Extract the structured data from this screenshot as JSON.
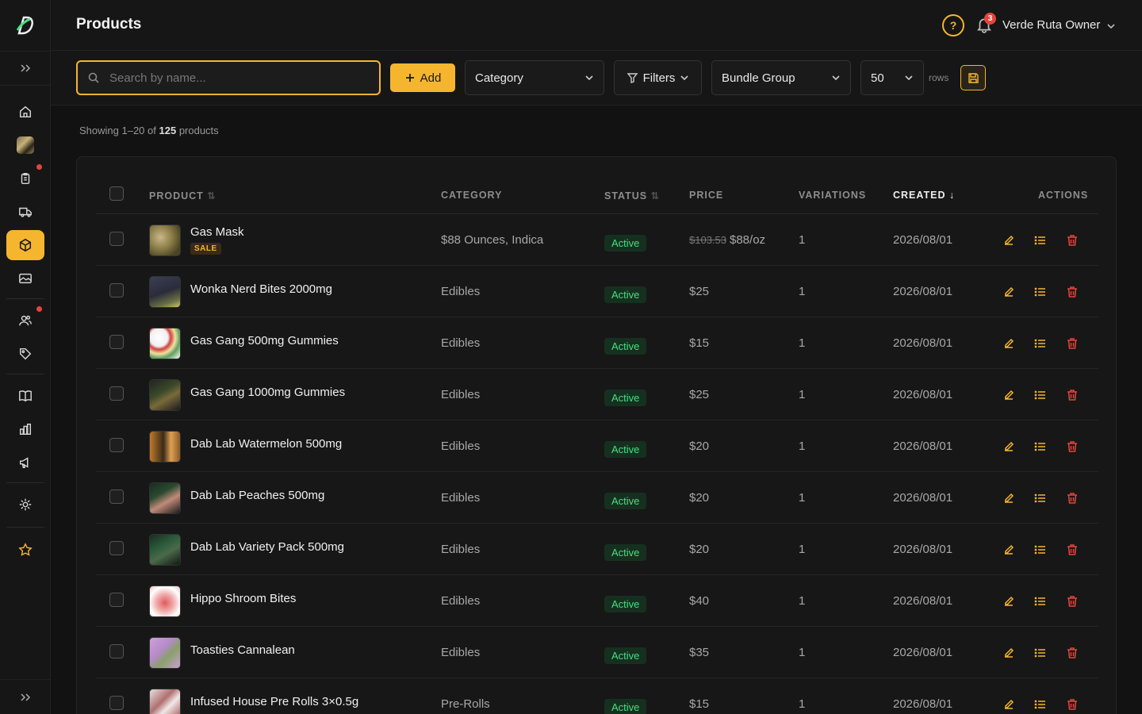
{
  "header": {
    "title": "Products",
    "help_label": "?",
    "notification_count": "3",
    "user_name": "Verde Ruta Owner"
  },
  "toolbar": {
    "search_placeholder": "Search by name...",
    "add_label": "Add",
    "category_label": "Category",
    "filters_label": "Filters",
    "bundle_label": "Bundle Group",
    "rows_value": "50",
    "rows_label": "rows"
  },
  "summary": {
    "prefix": "Showing 1–20 of",
    "total": "125",
    "suffix": "products"
  },
  "table": {
    "columns": {
      "product": "PRODUCT",
      "category": "CATEGORY",
      "status": "STATUS",
      "price": "PRICE",
      "variations": "VARIATIONS",
      "created": "CREATED",
      "actions": "ACTIONS"
    },
    "rows": [
      {
        "name": "Gas Mask",
        "badge": "SALE",
        "category": "$88 Ounces, Indica",
        "status": "Active",
        "old_price": "$103.53",
        "price": "$88/oz",
        "variations": "1",
        "created": "2026/08/01"
      },
      {
        "name": "Wonka Nerd Bites 2000mg",
        "category": "Edibles",
        "status": "Active",
        "price": "$25",
        "variations": "1",
        "created": "2026/08/01"
      },
      {
        "name": "Gas Gang 500mg Gummies",
        "category": "Edibles",
        "status": "Active",
        "price": "$15",
        "variations": "1",
        "created": "2026/08/01"
      },
      {
        "name": "Gas Gang 1000mg Gummies",
        "category": "Edibles",
        "status": "Active",
        "price": "$25",
        "variations": "1",
        "created": "2026/08/01"
      },
      {
        "name": "Dab Lab Watermelon 500mg",
        "category": "Edibles",
        "status": "Active",
        "price": "$20",
        "variations": "1",
        "created": "2026/08/01"
      },
      {
        "name": "Dab Lab Peaches 500mg",
        "category": "Edibles",
        "status": "Active",
        "price": "$20",
        "variations": "1",
        "created": "2026/08/01"
      },
      {
        "name": "Dab Lab Variety Pack 500mg",
        "category": "Edibles",
        "status": "Active",
        "price": "$20",
        "variations": "1",
        "created": "2026/08/01"
      },
      {
        "name": "Hippo Shroom Bites",
        "category": "Edibles",
        "status": "Active",
        "price": "$40",
        "variations": "1",
        "created": "2026/08/01"
      },
      {
        "name": "Toasties Cannalean",
        "category": "Edibles",
        "status": "Active",
        "price": "$35",
        "variations": "1",
        "created": "2026/08/01"
      },
      {
        "name": "Infused House Pre Rolls 3×0.5g",
        "category": "Pre-Rolls",
        "status": "Active",
        "price": "$15",
        "variations": "1",
        "created": "2026/08/01"
      }
    ]
  },
  "colors": {
    "accent": "#f5b52e",
    "status_active": "#4ade80",
    "delete": "#e5443b"
  }
}
